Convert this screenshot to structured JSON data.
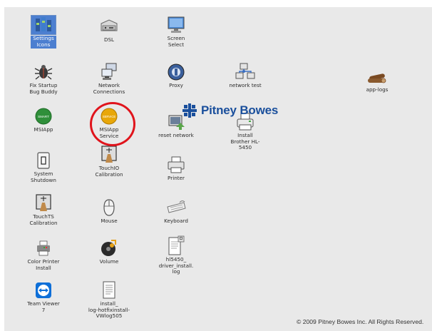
{
  "desktop": {
    "icons": {
      "settings_icons": {
        "label": "Settings\nIcons",
        "icon": "settings-icon"
      },
      "dsl": {
        "label": "DSL",
        "icon": "dsl-modem-icon"
      },
      "screen_select": {
        "label": "Screen\nSelect",
        "icon": "monitor-icon"
      },
      "fix_startup": {
        "label": "Fix Startup\nBug Buddy",
        "icon": "bug-icon"
      },
      "network_connections": {
        "label": "Network\nConnections",
        "icon": "network-icon"
      },
      "proxy": {
        "label": "Proxy",
        "icon": "proxy-icon"
      },
      "network_test": {
        "label": "network test",
        "icon": "network-test-icon"
      },
      "app_logs": {
        "label": "app-logs",
        "icon": "logs-icon"
      },
      "msi_app": {
        "label": "MSIApp",
        "icon": "msi-app-icon",
        "badge": "SMART"
      },
      "msi_app_service": {
        "label": "MSIApp\nService",
        "icon": "msi-service-icon",
        "badge": "SERVICE"
      },
      "reset_network": {
        "label": "reset network",
        "icon": "reset-network-icon"
      },
      "install_brother": {
        "label": "Install\nBrother HL-\n5450",
        "icon": "printer-install-icon"
      },
      "system_shutdown": {
        "label": "System\nShutdown",
        "icon": "power-icon"
      },
      "touchio_calibration": {
        "label": "TouchIO\nCalibration",
        "icon": "touch-calibration-icon"
      },
      "printer": {
        "label": "Printer",
        "icon": "printer-icon"
      },
      "touchts_calibration": {
        "label": "TouchTS\nCalibration",
        "icon": "touch-calibration-icon"
      },
      "mouse": {
        "label": "Mouse",
        "icon": "mouse-icon"
      },
      "keyboard": {
        "label": "Keyboard",
        "icon": "keyboard-icon"
      },
      "color_printer": {
        "label": "Color Printer\nInstall",
        "icon": "color-printer-icon"
      },
      "volume": {
        "label": "Volume",
        "icon": "volume-icon"
      },
      "hl5450_log": {
        "label": "hl5450_\ndriver_install.\nlog",
        "icon": "log-file-icon"
      },
      "team_viewer": {
        "label": "Team Viewer\n7",
        "icon": "teamviewer-icon"
      },
      "install_log": {
        "label": "install_\nlog-hotfixinstall-\nVWlog505",
        "icon": "document-icon"
      }
    },
    "selected": "settings_icons",
    "highlighted": "msi_app_service"
  },
  "brand": {
    "name": "Pitney Bowes"
  },
  "footer": {
    "copyright": "© 2009 Pitney Bowes Inc. All Rights Reserved."
  }
}
